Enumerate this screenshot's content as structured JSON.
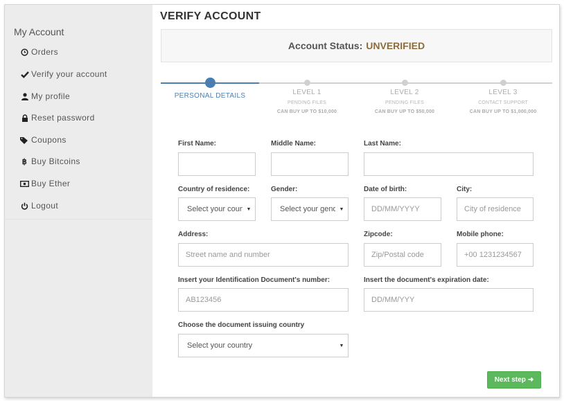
{
  "sidebar": {
    "title": "My Account",
    "items": [
      {
        "label": "Orders",
        "icon": "clock-icon"
      },
      {
        "label": "Verify your account",
        "icon": "check-icon"
      },
      {
        "label": "My profile",
        "icon": "user-icon"
      },
      {
        "label": "Reset password",
        "icon": "lock-icon"
      },
      {
        "label": "Coupons",
        "icon": "tag-icon"
      },
      {
        "label": "Buy Bitcoins",
        "icon": "bitcoin-icon"
      },
      {
        "label": "Buy Ether",
        "icon": "money-icon"
      },
      {
        "label": "Logout",
        "icon": "power-icon"
      }
    ]
  },
  "page": {
    "title": "VERIFY ACCOUNT",
    "status_label": "Account Status:",
    "status_value": "UNVERIFIED",
    "status_color": "#8a6d3b"
  },
  "steps": [
    {
      "label": "PERSONAL DETAILS",
      "sub": "",
      "cap": "",
      "active": true
    },
    {
      "label": "LEVEL 1",
      "sub": "PENDING FILES",
      "cap": "CAN BUY UP TO $10,000",
      "active": false
    },
    {
      "label": "LEVEL 2",
      "sub": "PENDING FILES",
      "cap": "CAN BUY UP TO $50,000",
      "active": false
    },
    {
      "label": "LEVEL 3",
      "sub": "CONTACT SUPPORT",
      "cap": "CAN BUY UP TO $1,000,000",
      "active": false
    }
  ],
  "form": {
    "first_name": {
      "label": "First Name:",
      "value": ""
    },
    "middle_name": {
      "label": "Middle Name:",
      "value": ""
    },
    "last_name": {
      "label": "Last Name:",
      "value": ""
    },
    "country": {
      "label": "Country of residence:",
      "selected": "Select your coun"
    },
    "gender": {
      "label": "Gender:",
      "selected": "Select your gend"
    },
    "dob": {
      "label": "Date of birth:",
      "placeholder": "DD/MM/YYYY"
    },
    "city": {
      "label": "City:",
      "placeholder": "City of residence"
    },
    "address": {
      "label": "Address:",
      "placeholder": "Street name and number"
    },
    "zipcode": {
      "label": "Zipcode:",
      "placeholder": "Zip/Postal code"
    },
    "mobile": {
      "label": "Mobile phone:",
      "placeholder": "+00 1231234567"
    },
    "id_number": {
      "label": "Insert your Identification Document's number:",
      "placeholder": "AB123456"
    },
    "id_expiry": {
      "label": "Insert the document's expiration date:",
      "placeholder": "DD/MM/YYY"
    },
    "issuing_country": {
      "label": "Choose the document issuing country",
      "selected": "Select your country"
    }
  },
  "buttons": {
    "next": "Next step"
  },
  "colors": {
    "accent": "#4a7eb1",
    "success": "#5cb85c"
  }
}
